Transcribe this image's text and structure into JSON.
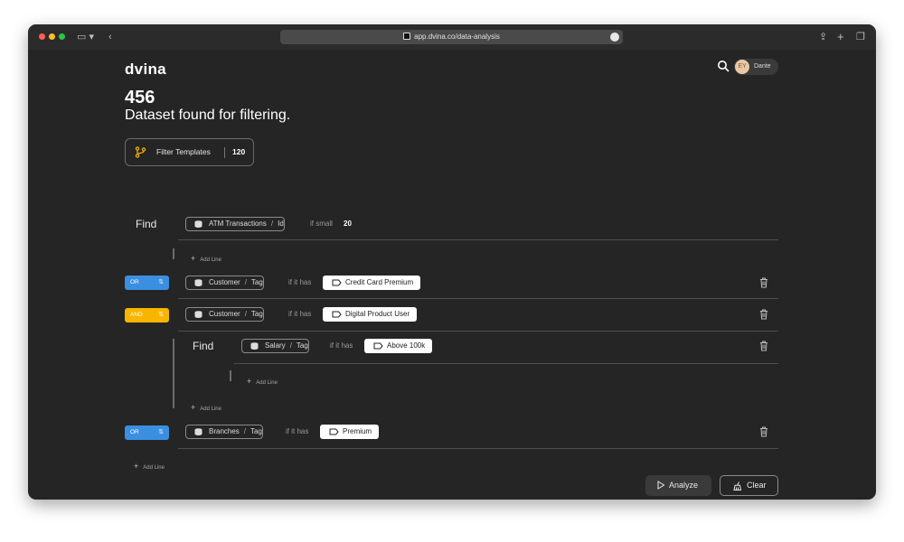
{
  "browser": {
    "url": "app.dvina.co/data-analysis"
  },
  "header": {
    "logo": "dvina",
    "user": {
      "initials": "EY",
      "name": "Dante"
    }
  },
  "summary": {
    "count": "456",
    "subtitle": "Dataset found for filtering."
  },
  "templates": {
    "label": "Filter Templates",
    "count": "120"
  },
  "query": {
    "find_label": "Find",
    "root": {
      "table": "ATM Transactions",
      "field": "Id",
      "condition": "if small",
      "value": "20"
    },
    "add_line": "Add Line",
    "rows": [
      {
        "logic": "OR",
        "table": "Customer",
        "field": "Tag",
        "condition": "if it has",
        "tag": "Credit Card Premium"
      },
      {
        "logic": "AND",
        "table": "Customer",
        "field": "Tag",
        "condition": "if it has",
        "tag": "Digital Product User"
      }
    ],
    "group": {
      "find_label": "Find",
      "table": "Salary",
      "field": "Tag",
      "condition": "if it has",
      "tag": "Above 100k",
      "inner_add_line": "Add Line",
      "outer_add_line": "Add Line"
    },
    "last_row": {
      "logic": "OR",
      "table": "Branches",
      "field": "Tag",
      "condition": "if it has",
      "tag": "Premium"
    },
    "bottom_add_line": "Add Line"
  },
  "actions": {
    "analyze": "Analyze",
    "clear": "Clear"
  },
  "colors": {
    "or": "#3b8fe0",
    "and": "#f7b500",
    "background": "#252525"
  }
}
